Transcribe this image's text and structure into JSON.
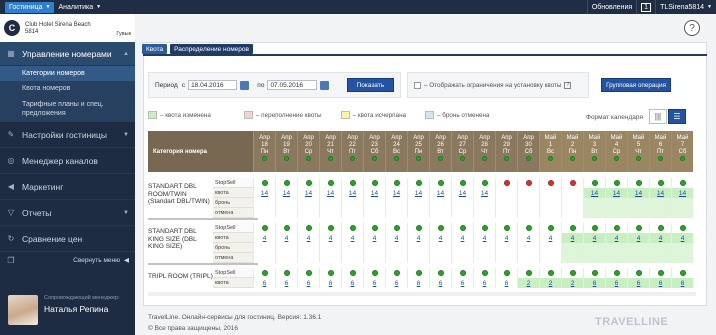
{
  "topbar": {
    "hotel_menu": "Гостиница",
    "analytics_menu": "Аналитика",
    "updates": "Обновления",
    "notifications": "1",
    "user": "TLSirena5814"
  },
  "hotel": {
    "name": "Club Hotel Sirena Beach",
    "id": "5814",
    "user_label": "Гувык",
    "logo": "C"
  },
  "nav": {
    "rooms_management": "Управление номерами",
    "sub": [
      "Категории номеров",
      "Квота номеров",
      "Тарифные планы и спец. предложения"
    ],
    "settings": "Настройки гостиницы",
    "channel_manager": "Менеджер каналов",
    "marketing": "Маркетинг",
    "reports": "Отчеты",
    "price_compare": "Сравнение цен",
    "collapse": "Свернуть меню"
  },
  "manager": {
    "label": "Сопровождающий менеджер:",
    "name": "Наталья Репина"
  },
  "tabs": [
    "Квота",
    "Распределение номеров"
  ],
  "filter": {
    "period_label": "Период",
    "from_label": "с",
    "from_date": "18.04.2016",
    "to_label": "по",
    "to_date": "07.05.2016",
    "show_button": "Показать"
  },
  "checkbox_label": "– Отображать ограничения на установку квоты",
  "help_mark": "?",
  "group_button": "Групповая операция",
  "legend": [
    {
      "label": "– квота изменена",
      "color": "#c8efc2"
    },
    {
      "label": "– переполнение квоты",
      "color": "#f6d0cc"
    },
    {
      "label": "– квота исчерпана",
      "color": "#fbf3a6"
    },
    {
      "label": "– бронь отменена",
      "color": "#cfe6f3"
    }
  ],
  "format_label": "Формат календаря",
  "grid": {
    "category_header": "Категория номера",
    "days": [
      [
        "Апр",
        "18",
        "Пн"
      ],
      [
        "Апр",
        "19",
        "Вт"
      ],
      [
        "Апр",
        "20",
        "Ср"
      ],
      [
        "Апр",
        "21",
        "Чт"
      ],
      [
        "Апр",
        "22",
        "Пт"
      ],
      [
        "Апр",
        "23",
        "Сб"
      ],
      [
        "Апр",
        "24",
        "Вс"
      ],
      [
        "Апр",
        "25",
        "Пн"
      ],
      [
        "Апр",
        "26",
        "Вт"
      ],
      [
        "Апр",
        "27",
        "Ср"
      ],
      [
        "Апр",
        "28",
        "Чт"
      ],
      [
        "Апр",
        "29",
        "Пт"
      ],
      [
        "Апр",
        "30",
        "Сб"
      ],
      [
        "Май",
        "1",
        "Вс"
      ],
      [
        "Май",
        "2",
        "Пн"
      ],
      [
        "Май",
        "3",
        "Вт"
      ],
      [
        "Май",
        "4",
        "Ср"
      ],
      [
        "Май",
        "5",
        "Чт"
      ],
      [
        "Май",
        "6",
        "Пт"
      ],
      [
        "Май",
        "7",
        "Сб"
      ]
    ],
    "row_labels": [
      "StopSell",
      "квота",
      "бронь",
      "отмена"
    ],
    "rooms": [
      {
        "name": "STANDART DBL ROOM/TWIN (Standart DBL/TWIN)",
        "stopsell": [
          "g",
          "g",
          "g",
          "g",
          "g",
          "g",
          "g",
          "g",
          "g",
          "g",
          "g",
          "r",
          "r",
          "r",
          "r",
          "g",
          "g",
          "g",
          "g",
          "g"
        ],
        "quota": [
          "14",
          "14",
          "14",
          "14",
          "14",
          "14",
          "14",
          "14",
          "14",
          "14",
          "14",
          "",
          "",
          "",
          "",
          "14",
          "14",
          "14",
          "14",
          "14"
        ],
        "changed_from": 15
      },
      {
        "name": "STANDART DBL KING SIZE (DBL KING SIZE)",
        "stopsell": [
          "g",
          "g",
          "g",
          "g",
          "g",
          "g",
          "g",
          "g",
          "g",
          "g",
          "g",
          "g",
          "g",
          "g",
          "g",
          "g",
          "g",
          "g",
          "g",
          "g"
        ],
        "quota": [
          "4",
          "4",
          "4",
          "4",
          "4",
          "4",
          "4",
          "4",
          "4",
          "4",
          "4",
          "4",
          "4",
          "4",
          "4",
          "4",
          "4",
          "4",
          "4",
          "4"
        ],
        "changed_from": 14
      },
      {
        "name": "TRIPL ROOM (TRIPL)",
        "stopsell": [
          "g",
          "g",
          "g",
          "g",
          "g",
          "g",
          "g",
          "g",
          "g",
          "g",
          "g",
          "g",
          "g",
          "g",
          "g",
          "g",
          "g",
          "g",
          "g",
          "g"
        ],
        "quota": [
          "6",
          "6",
          "6",
          "6",
          "6",
          "6",
          "6",
          "6",
          "6",
          "6",
          "6",
          "6",
          "2",
          "2",
          "2",
          "6",
          "6",
          "6",
          "6",
          "6"
        ],
        "changed_from": 12
      }
    ]
  },
  "footer": {
    "line1": "TravelLine. Онлайн-сервисы для гостиниц. Версия: 1.36.1",
    "line2": "© Все права защищены, 2016"
  },
  "brand": "TRAVELLINE"
}
